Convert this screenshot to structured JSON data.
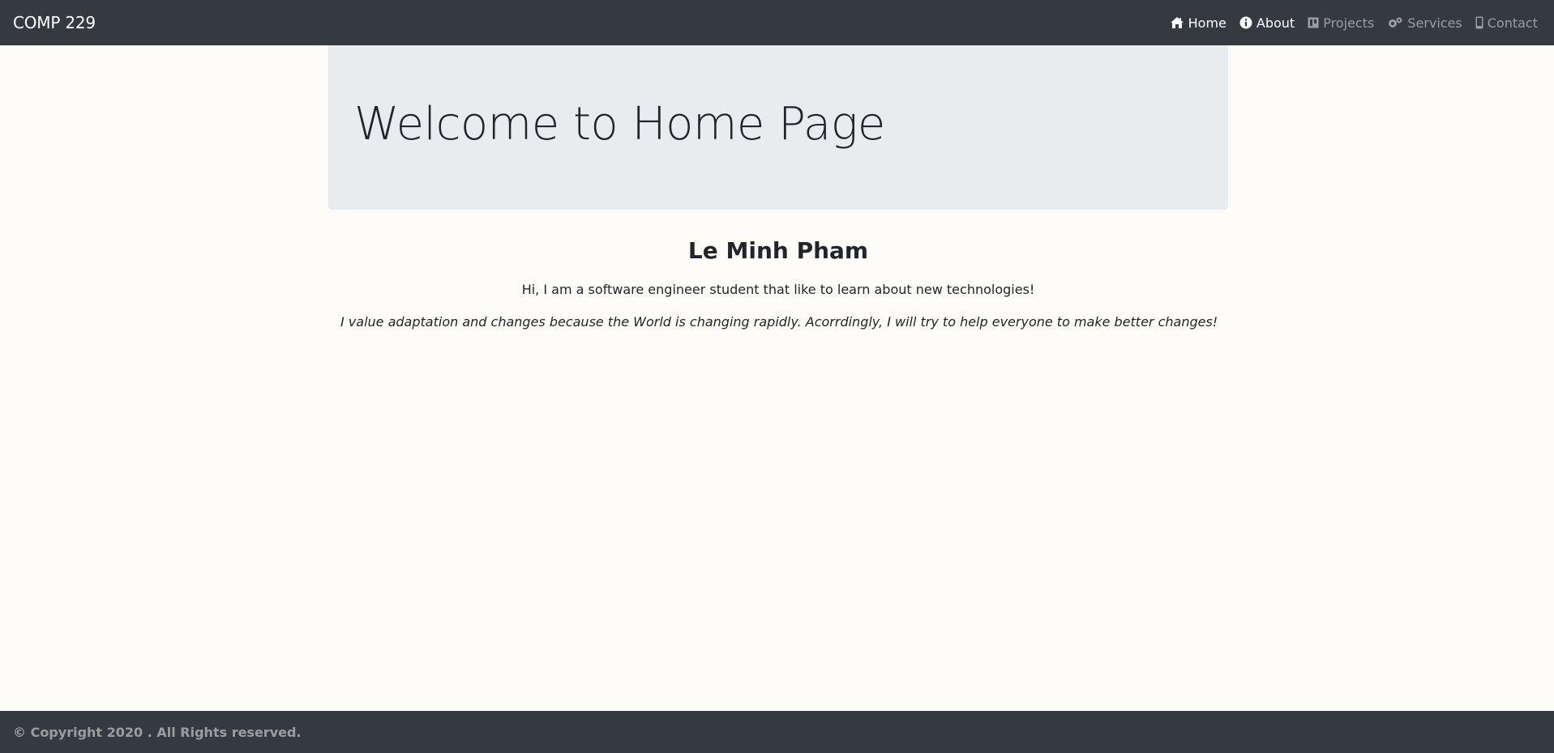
{
  "navbar": {
    "brand": "COMP 229",
    "items": [
      {
        "label": "Home",
        "icon": "home-icon",
        "active": true
      },
      {
        "label": "About",
        "icon": "info-icon",
        "active": true
      },
      {
        "label": "Projects",
        "icon": "projects-icon",
        "active": false
      },
      {
        "label": "Services",
        "icon": "gears-icon",
        "active": false
      },
      {
        "label": "Contact",
        "icon": "mobile-icon",
        "active": false
      }
    ]
  },
  "jumbotron": {
    "title": "Welcome to Home Page"
  },
  "main": {
    "name": "Le Minh Pham",
    "intro": "Hi, I am a software engineer student that like to learn about new technologies!",
    "quote": "I value adaptation and changes because the World is changing rapidly. Acorrdingly, I will try to help everyone to make better changes!"
  },
  "footer": {
    "copyright": "© Copyright 2020 . All Rights reserved."
  },
  "colors": {
    "navbar_bg": "#343a40",
    "jumbotron_bg": "#e9ecef",
    "page_bg": "#fdfcf9",
    "text": "#212529"
  }
}
